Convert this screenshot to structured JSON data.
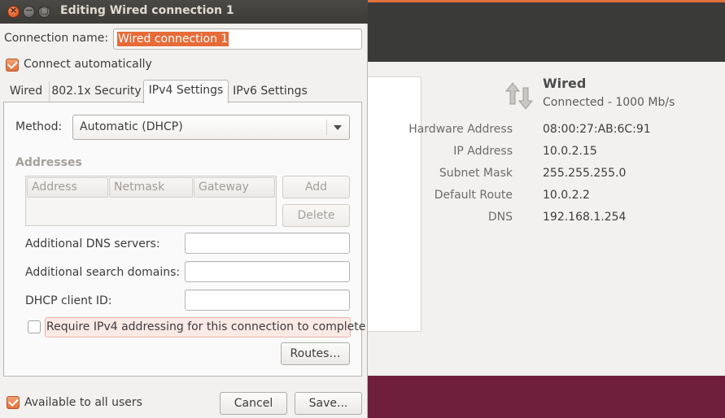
{
  "background": {
    "device": {
      "title": "Wired",
      "status": "Connected - 1000 Mb/s",
      "icon": "network-wired-icon"
    },
    "info": [
      {
        "key": "Hardware Address",
        "value": "08:00:27:AB:6C:91"
      },
      {
        "key": "IP Address",
        "value": "10.0.2.15"
      },
      {
        "key": "Subnet Mask",
        "value": "255.255.255.0"
      },
      {
        "key": "Default Route",
        "value": "10.0.2.2"
      },
      {
        "key": "DNS",
        "value": "192.168.1.254"
      }
    ]
  },
  "dialog": {
    "title": "Editing Wired connection 1",
    "window_buttons": {
      "close": "×",
      "minimize": "−",
      "maximize": "□"
    },
    "connection_name_label": "Connection name:",
    "connection_name_value": "Wired connection 1",
    "connect_automatically": {
      "label": "Connect automatically",
      "checked": true
    },
    "tabs": [
      "Wired",
      "802.1x Security",
      "IPv4 Settings",
      "IPv6 Settings"
    ],
    "active_tab": "IPv4 Settings",
    "method_label": "Method:",
    "method_value": "Automatic (DHCP)",
    "addresses_title": "Addresses",
    "address_columns": [
      "Address",
      "Netmask",
      "Gateway"
    ],
    "add_button": "Add",
    "delete_button": "Delete",
    "dns_label": "Additional DNS servers:",
    "search_domains_label": "Additional search domains:",
    "dhcp_client_id_label": "DHCP client ID:",
    "require_ipv4": {
      "label": "Require IPv4 addressing for this connection to complete",
      "checked": false
    },
    "routes_button": "Routes…",
    "available_to_all_users": {
      "label": "Available to all users",
      "checked": true
    },
    "cancel_button": "Cancel",
    "save_button": "Save..."
  },
  "colors": {
    "accent": "#e66b39",
    "titlebar": "#3c3b37",
    "desktop": "#6f1f3c"
  }
}
